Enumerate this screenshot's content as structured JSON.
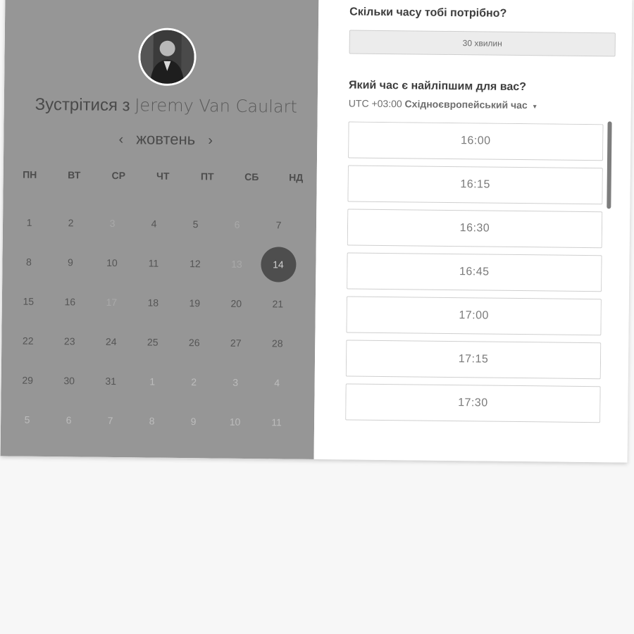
{
  "host": {
    "prefix": "Зустрітися з",
    "name": "Jeremy Van Caulart"
  },
  "calendar": {
    "month": "жовтень",
    "prev_arrow": "‹",
    "next_arrow": "›",
    "weekdays": [
      "ПН",
      "ВТ",
      "СР",
      "ЧТ",
      "ПТ",
      "СБ",
      "НД"
    ],
    "days": [
      [
        "1",
        "2",
        "3",
        "4",
        "5",
        "6",
        "7"
      ],
      [
        "8",
        "9",
        "10",
        "11",
        "12",
        "13",
        "14"
      ],
      [
        "15",
        "16",
        "17",
        "18",
        "19",
        "20",
        "21"
      ],
      [
        "22",
        "23",
        "24",
        "25",
        "26",
        "27",
        "28"
      ],
      [
        "29",
        "30",
        "31",
        "1",
        "2",
        "3",
        "4"
      ],
      [
        "5",
        "6",
        "7",
        "8",
        "9",
        "10",
        "11"
      ]
    ],
    "selected_day": "14"
  },
  "duration": {
    "question": "Скільки часу тобі потрібно?",
    "value": "30 хвилин"
  },
  "time": {
    "question": "Який час є найліпшим для вас?",
    "tz_offset": "UTC +03:00",
    "tz_name": "Східноєвропейський час",
    "slots": [
      "16:00",
      "16:15",
      "16:30",
      "16:45",
      "17:00",
      "17:15",
      "17:30",
      ""
    ]
  },
  "colors": {
    "left_panel": "#969696",
    "selected_day": "#4e4e4e"
  }
}
